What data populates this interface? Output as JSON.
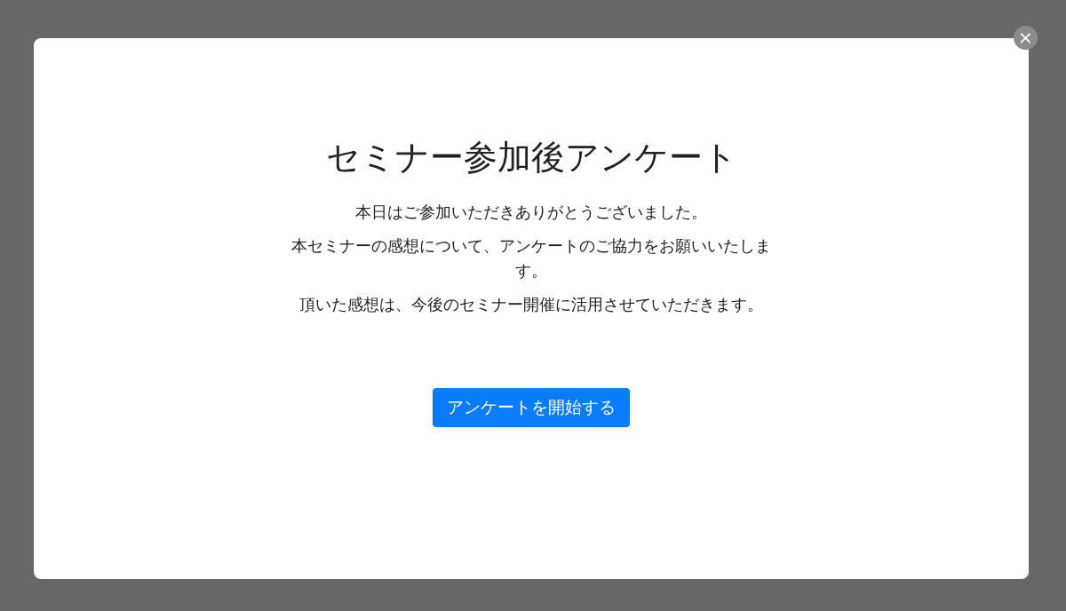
{
  "dialog": {
    "close_button": "×",
    "title": "セミナー参加後アンケート",
    "paragraphs": [
      "本日はご参加いただきありがとうございました。",
      "本セミナーの感想について、アンケートのご協力をお願いいたします。",
      "頂いた感想は、今後のセミナー開催に活用させていただきます。"
    ],
    "button": "アンケートを開始する"
  }
}
